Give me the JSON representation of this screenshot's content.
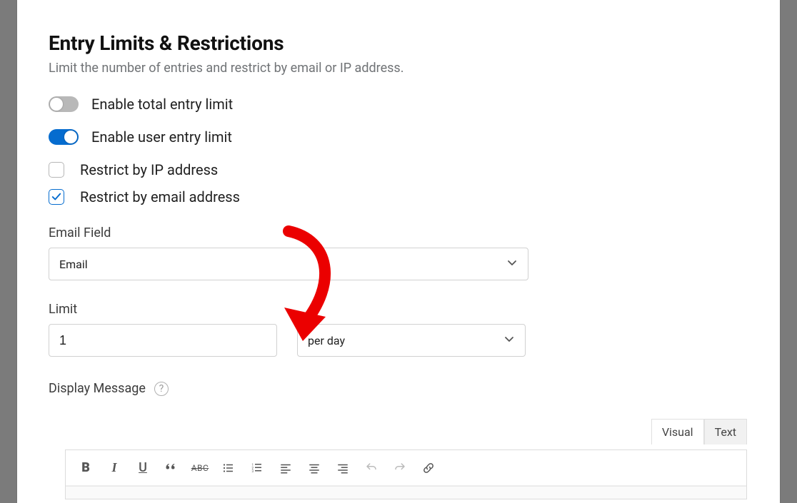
{
  "section": {
    "title": "Entry Limits & Restrictions",
    "description": "Limit the number of entries and restrict by email or IP address."
  },
  "toggles": {
    "total_limit": {
      "label": "Enable total entry limit",
      "on": false
    },
    "user_limit": {
      "label": "Enable user entry limit",
      "on": true
    }
  },
  "checkboxes": {
    "restrict_ip": {
      "label": "Restrict by IP address",
      "checked": false
    },
    "restrict_email": {
      "label": "Restrict by email address",
      "checked": true
    }
  },
  "email_field": {
    "label": "Email Field",
    "value": "Email"
  },
  "limit": {
    "label": "Limit",
    "value": "1",
    "period": "per day"
  },
  "display_message": {
    "label": "Display Message",
    "tabs": {
      "visual": "Visual",
      "text": "Text"
    },
    "active_tab": "visual"
  },
  "toolbar_icons": {
    "bold": "B",
    "italic": "I",
    "underline": "U",
    "quote": "❝❝",
    "strike": "ABC"
  }
}
